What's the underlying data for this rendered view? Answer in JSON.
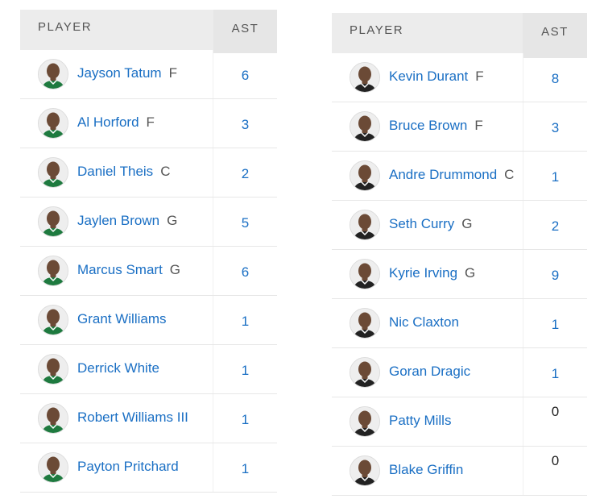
{
  "left": {
    "header": {
      "player": "PLAYER",
      "ast": "AST"
    },
    "rows": [
      {
        "name": "Jayson Tatum",
        "pos": "F",
        "ast": "6"
      },
      {
        "name": "Al Horford",
        "pos": "F",
        "ast": "3"
      },
      {
        "name": "Daniel Theis",
        "pos": "C",
        "ast": "2"
      },
      {
        "name": "Jaylen Brown",
        "pos": "G",
        "ast": "5"
      },
      {
        "name": "Marcus Smart",
        "pos": "G",
        "ast": "6"
      },
      {
        "name": "Grant Williams",
        "pos": "",
        "ast": "1"
      },
      {
        "name": "Derrick White",
        "pos": "",
        "ast": "1"
      },
      {
        "name": "Robert Williams III",
        "pos": "",
        "ast": "1"
      },
      {
        "name": "Payton Pritchard",
        "pos": "",
        "ast": "1"
      }
    ]
  },
  "right": {
    "header": {
      "player": "PLAYER",
      "ast": "AST"
    },
    "rows": [
      {
        "name": "Kevin Durant",
        "pos": "F",
        "ast": "8"
      },
      {
        "name": "Bruce Brown",
        "pos": "F",
        "ast": "3"
      },
      {
        "name": "Andre Drummond",
        "pos": "C",
        "ast": "1"
      },
      {
        "name": "Seth Curry",
        "pos": "G",
        "ast": "2"
      },
      {
        "name": "Kyrie Irving",
        "pos": "G",
        "ast": "9"
      },
      {
        "name": "Nic Claxton",
        "pos": "",
        "ast": "1"
      },
      {
        "name": "Goran Dragic",
        "pos": "",
        "ast": "1"
      },
      {
        "name": "Patty Mills",
        "pos": "",
        "ast": "0"
      },
      {
        "name": "Blake Griffin",
        "pos": "",
        "ast": "0"
      }
    ]
  },
  "colors": {
    "link": "#1a6fc4",
    "header_bg": "#ececec",
    "celtics_jersey": "#1e7a3f",
    "nets_jersey": "#222222"
  },
  "icons": {
    "avatar": "player-headshot-icon"
  }
}
